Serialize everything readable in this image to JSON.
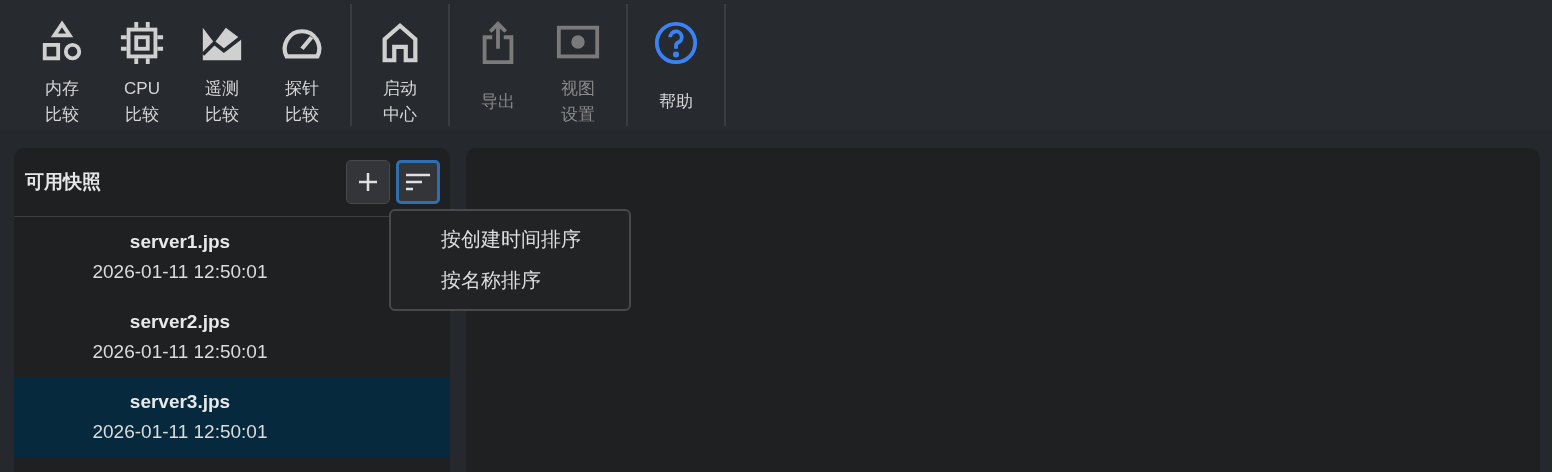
{
  "toolbar": {
    "groups": [
      {
        "buttons": [
          {
            "label": "内存比较",
            "disabled": false
          },
          {
            "label": "CPU比较",
            "disabled": false
          },
          {
            "label": "遥测比较",
            "disabled": false
          },
          {
            "label": "探针比较",
            "disabled": false
          }
        ]
      },
      {
        "buttons": [
          {
            "label": "启动中心",
            "disabled": false
          }
        ]
      },
      {
        "buttons": [
          {
            "label": "导出",
            "disabled": true
          },
          {
            "label": "视图设置",
            "disabled": true
          }
        ]
      },
      {
        "buttons": [
          {
            "label": "帮助",
            "disabled": false
          }
        ]
      }
    ]
  },
  "snapshots": {
    "title": "可用快照",
    "sort_open": true,
    "sort_menu": [
      "按创建时间排序",
      "按名称排序"
    ],
    "items": [
      {
        "name": "server1.jps",
        "date": "2026-01-11 12:50:01",
        "selected": false
      },
      {
        "name": "server2.jps",
        "date": "2026-01-11 12:50:01",
        "selected": false
      },
      {
        "name": "server3.jps",
        "date": "2026-01-11 12:50:01",
        "selected": true
      }
    ]
  }
}
